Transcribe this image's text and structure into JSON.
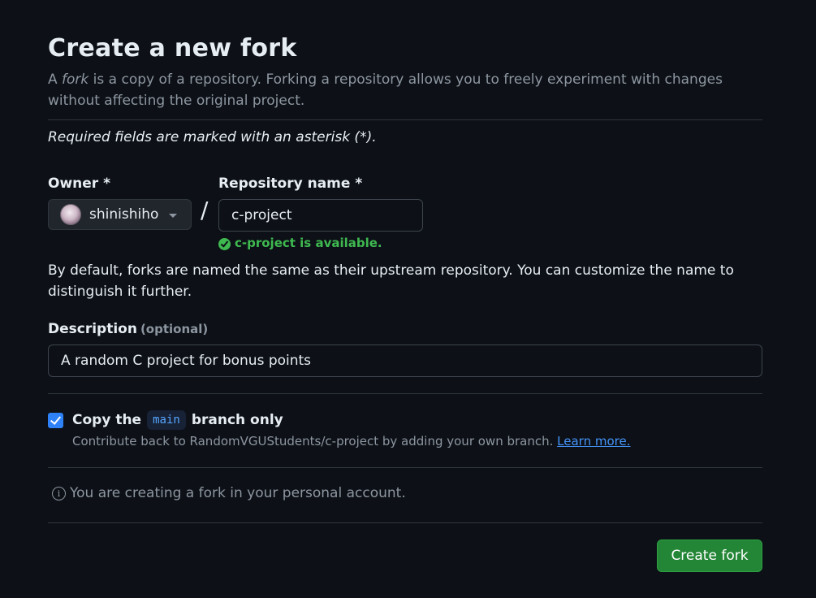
{
  "header": {
    "title": "Create a new fork",
    "subtitle_prefix": "A ",
    "subtitle_em": "fork",
    "subtitle_suffix": " is a copy of a repository. Forking a repository allows you to freely experiment with changes without affecting the original project."
  },
  "form": {
    "required_note": "Required fields are marked with an asterisk (*).",
    "owner": {
      "label": "Owner *",
      "selected": "shinishiho",
      "avatar_icon": "user-avatar"
    },
    "separator": "/",
    "repo_name": {
      "label": "Repository name *",
      "value": "c-project",
      "availability": "c-project is available.",
      "availability_color": "#3fb950"
    },
    "default_note": "By default, forks are named the same as their upstream repository. You can customize the name to distinguish it further.",
    "description": {
      "label": "Description",
      "optional": "(optional)",
      "value": "A random C project for bonus points"
    },
    "copy_branch": {
      "checked": true,
      "label_prefix": "Copy the",
      "branch": "main",
      "label_suffix": "branch only",
      "help": "Contribute back to RandomVGUStudents/c-project by adding your own branch.",
      "learn_more": "Learn more."
    },
    "info": {
      "icon": "info-icon",
      "text": "You are creating a fork in your personal account."
    },
    "submit_label": "Create fork"
  },
  "colors": {
    "background": "#0d1117",
    "primary_button": "#238636",
    "link": "#4493f8",
    "checkbox": "#2f81f7"
  }
}
